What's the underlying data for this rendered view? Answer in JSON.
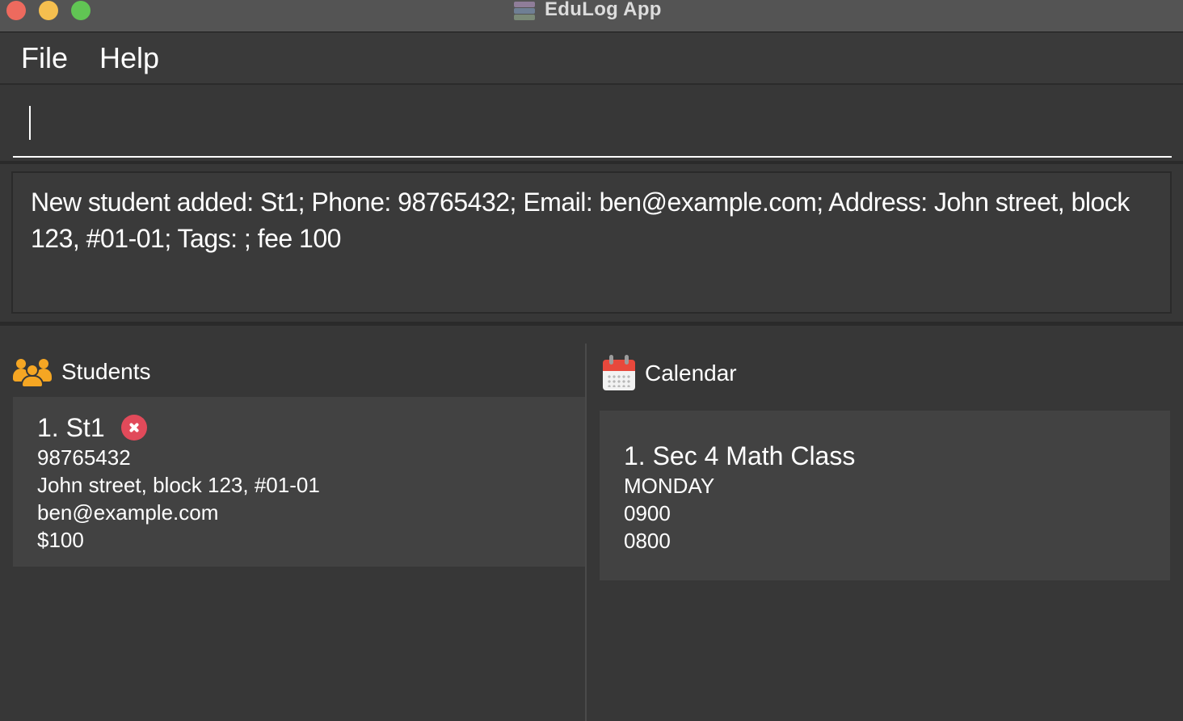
{
  "window": {
    "title": "EduLog App",
    "icon": "books-stack-icon"
  },
  "menu": {
    "items": [
      "File",
      "Help"
    ]
  },
  "command_box": {
    "value": "",
    "placeholder": ""
  },
  "result_display": {
    "text": "New student added: St1; Phone: 98765432; Email: ben@example.com; Address: John street, block 123, #01-01; Tags: ; fee 100"
  },
  "students_panel": {
    "title": "Students",
    "icon": "people-group-icon",
    "items": [
      {
        "name": "1. St1",
        "phone": "98765432",
        "address": "John street, block 123, #01-01",
        "email": "ben@example.com",
        "fee": "$100",
        "delete_icon": "delete-x-icon"
      }
    ]
  },
  "calendar_panel": {
    "title": "Calendar",
    "icon": "calendar-icon",
    "items": [
      {
        "name": "1. Sec 4 Math Class",
        "day": "MONDAY",
        "start": "0900",
        "end": "0800"
      }
    ]
  },
  "colors": {
    "background": "#373737",
    "title_bar": "#545454",
    "card": "#424242",
    "accent_orange": "#f5a623",
    "delete_red": "#e14a5a"
  }
}
